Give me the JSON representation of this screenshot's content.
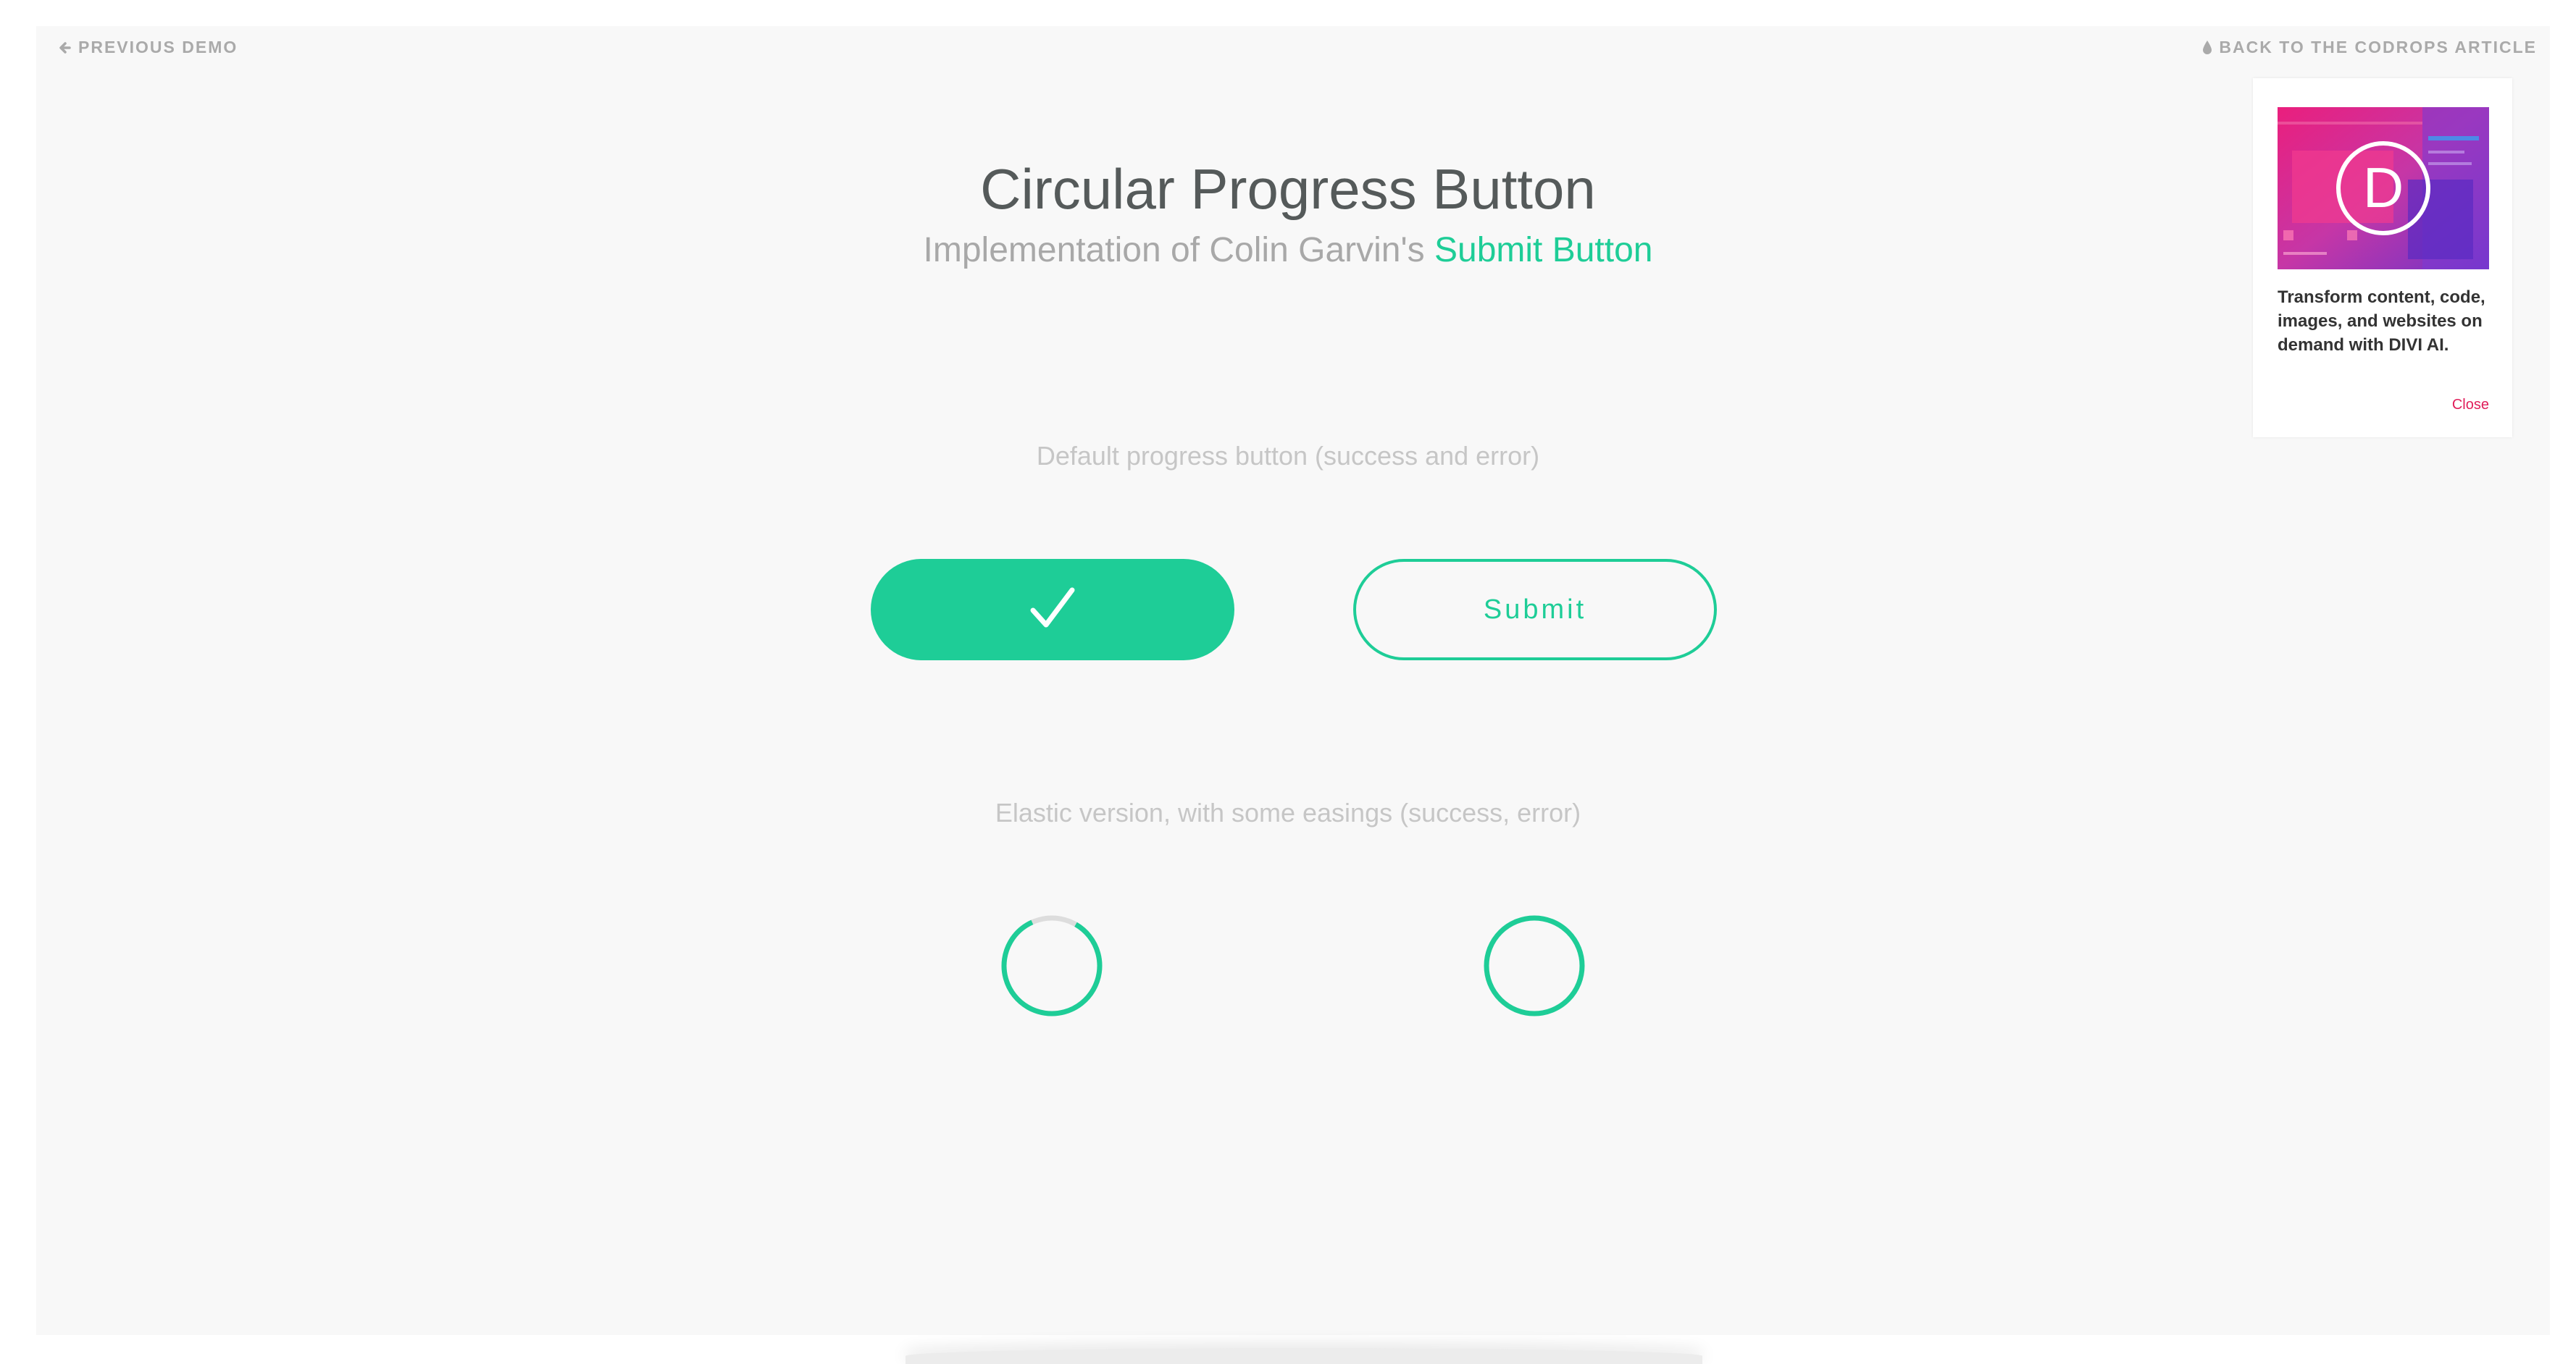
{
  "nav": {
    "previous_demo": "PREVIOUS DEMO",
    "back_to_article": "BACK TO THE CODROPS ARTICLE"
  },
  "header": {
    "title": "Circular Progress Button",
    "subtitle_prefix": "Implementation of Colin Garvin's ",
    "subtitle_link": "Submit Button"
  },
  "sections": {
    "default_label": "Default progress button (success and error)",
    "elastic_label": "Elastic version, with some easings (success, error)"
  },
  "buttons": {
    "success_icon": "checkmark-icon",
    "submit_label": "Submit"
  },
  "ad": {
    "logo_letter": "D",
    "text": "Transform content, code, images, and websites on demand with DIVI AI.",
    "close_label": "Close"
  },
  "colors": {
    "accent": "#1ecd97",
    "title": "#555a5a",
    "muted": "#a8a8a8",
    "close": "#e01e5a"
  }
}
